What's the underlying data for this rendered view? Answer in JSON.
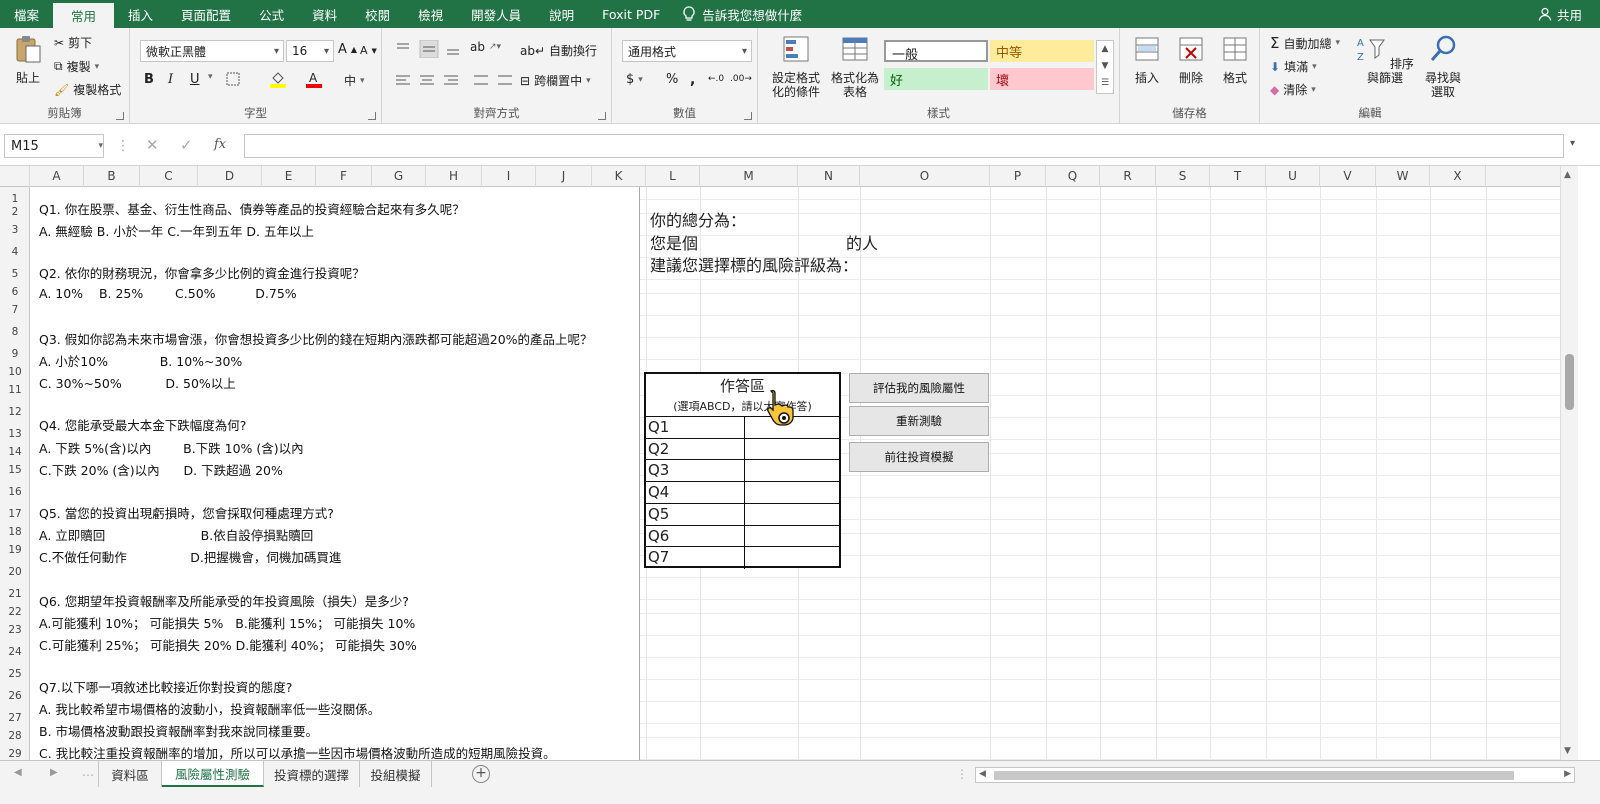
{
  "ribbon_tabs": [
    "檔案",
    "常用",
    "插入",
    "頁面配置",
    "公式",
    "資料",
    "校閱",
    "檢視",
    "開發人員",
    "說明",
    "Foxit PDF"
  ],
  "active_tab": "常用",
  "tell_me": "告訴我您想做什麼",
  "share": "共用",
  "clipboard": {
    "paste": "貼上",
    "cut": "剪下",
    "copy": "複製",
    "format_painter": "複製格式",
    "label": "剪貼簿"
  },
  "font": {
    "name": "微軟正黑體",
    "size": "16",
    "bold": "B",
    "italic": "I",
    "underline": "U",
    "label": "字型"
  },
  "alignment": {
    "wrap": "自動換行",
    "merge": "跨欄置中",
    "label": "對齊方式"
  },
  "number": {
    "format": "通用格式",
    "currency": "$",
    "percent": "%",
    "comma": ",",
    "label": "數值"
  },
  "styles": {
    "conditional": "設定格式化的條件",
    "table": "格式化為表格",
    "normal": "一般",
    "neutral": "中等",
    "good": "好",
    "bad": "壞",
    "label": "樣式"
  },
  "cells": {
    "insert": "插入",
    "delete": "刪除",
    "format": "格式",
    "label": "儲存格"
  },
  "editing": {
    "autosum": "自動加總",
    "fill": "填滿",
    "clear": "清除",
    "sort": "排序與篩選",
    "find": "尋找與選取",
    "label": "編輯"
  },
  "name_box": "M15",
  "fx": "fx",
  "columns": [
    "A",
    "B",
    "C",
    "D",
    "E",
    "F",
    "G",
    "H",
    "I",
    "J",
    "K",
    "L",
    "M",
    "N",
    "O",
    "P",
    "Q",
    "R",
    "S",
    "T",
    "U",
    "V",
    "W",
    "X"
  ],
  "rows": [
    "1",
    "2",
    "3",
    "4",
    "5",
    "6",
    "7",
    "8",
    "9",
    "10",
    "11",
    "12",
    "13",
    "14",
    "15",
    "16",
    "17",
    "18",
    "19",
    "20",
    "21",
    "22",
    "23",
    "24",
    "25",
    "26",
    "27",
    "28",
    "29",
    "30",
    "31",
    "32"
  ],
  "questions": [
    "Q1. 你在股票、基金、衍生性商品、債券等產品的投資經驗合起來有多久呢？",
    "A. 無經驗 B. 小於一年 C.一年到五年 D. 五年以上",
    "Q2. 依你的財務現況，你會拿多少比例的資金進行投資呢？",
    "A. 10%    B. 25%        C.50%          D.75%",
    "Q3. 假如你認為未來市場會漲，你會想投資多少比例的錢在短期內漲跌都可能超過20%的產品上呢？",
    "A. 小於10%             B. 10%~30%",
    "C. 30%~50%           D. 50%以上",
    "Q4. 您能承受最大本金下跌幅度為何?",
    "A. 下跌 5%(含)以內        B.下跌 10% (含)以內",
    "C.下跌 20% (含)以內      D. 下跌超過 20%",
    "Q5. 當您的投資出現虧損時，您會採取何種處理方式?",
    "A. 立即贖回                        B.依自設停損點贖回",
    "C.不做任何動作                D.把握機會，伺機加碼買進",
    "Q6. 您期望年投資報酬率及所能承受的年投資風險（損失）是多少?",
    "A.可能獲利 10%； 可能損失 5%   B.能獲利 15%； 可能損失 10%",
    "C.可能獲利 25%； 可能損失 20% D.能獲利 40%； 可能損失 30%",
    "Q7.以下哪一項敘述比較接近你對投資的態度?",
    "A. 我比較希望市場價格的波動小，投資報酬率低一些沒關係。",
    "B. 市場價格波動跟投資報酬率對我來說同樣重要。",
    "C. 我比較注重投資報酬率的增加，所以可以承擔一些因市場價格波動所造成的短期風險投資。"
  ],
  "result": {
    "total": "你的總分為：",
    "type_prefix": "您是個",
    "type_suffix": "的人",
    "advice": "建議您選擇標的風險評級為："
  },
  "answer_box": {
    "title": "作答區",
    "subtitle": "(選項ABCD，請以大寫作答)",
    "questions": [
      "Q1",
      "Q2",
      "Q3",
      "Q4",
      "Q5",
      "Q6",
      "Q7"
    ]
  },
  "buttons": {
    "evaluate": "評估我的風險屬性",
    "retest": "重新測驗",
    "simulate": "前往投資模擬"
  },
  "sheets": [
    "資料區",
    "風險屬性測驗",
    "投資標的選擇",
    "投組模擬"
  ],
  "active_sheet": "風險屬性測驗",
  "accent": "#217346"
}
